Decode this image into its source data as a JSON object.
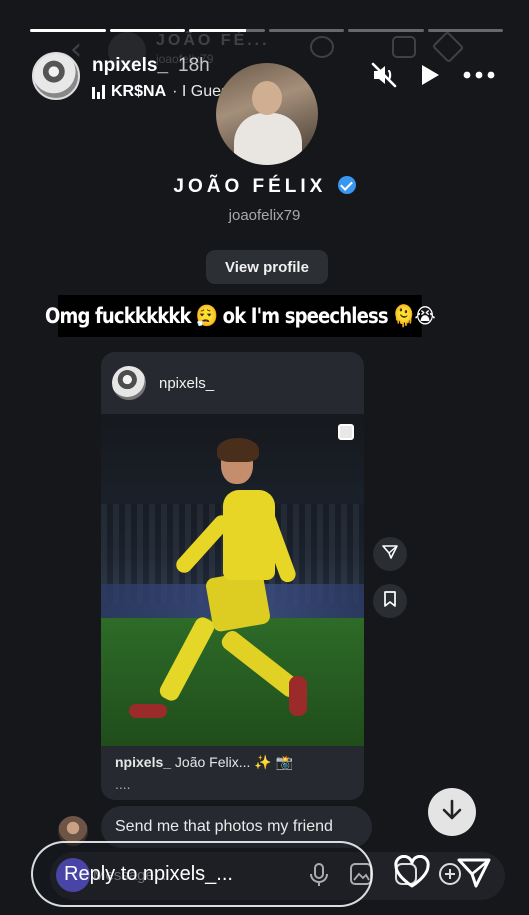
{
  "story": {
    "progress": [
      1,
      1,
      0.75,
      0,
      0,
      0
    ],
    "username": "npixels_",
    "time": "18h",
    "music_artist": "KR$NA",
    "music_song": "· I Guess"
  },
  "dm_header": {
    "name": "JOÃO FÉ...",
    "handle": "joaofelix79"
  },
  "profile": {
    "name": "JOÃO FÉLIX",
    "handle": "joaofelix79",
    "view_profile": "View profile"
  },
  "caption": {
    "text": "Omg fuckkkkkk",
    "mid": "ok I'm speechless",
    "emoji_1": "😮‍💨",
    "emoji_2": "🫠😭"
  },
  "post": {
    "username": "npixels_",
    "caption_user": "npixels_",
    "caption_text": "João Felix... ✨ 📸",
    "more": "...."
  },
  "message": {
    "text": "Send me that photos my friend"
  },
  "reply": {
    "placeholder": "Reply to npixels_...",
    "ghost": "Message..."
  },
  "icons": {
    "mute": "speaker-muted-icon",
    "play": "play-icon",
    "more": "more-dots-icon",
    "share": "paper-plane-icon",
    "save": "bookmark-icon",
    "scroll": "arrow-down-icon",
    "heart": "heart-icon",
    "mic": "microphone-icon",
    "gallery": "image-icon",
    "sticker": "sticker-icon",
    "plus": "plus-circle-icon"
  },
  "colors": {
    "background": "#15171b",
    "card": "#262a30",
    "verified": "#3897f0",
    "jersey": "#e7d626"
  }
}
